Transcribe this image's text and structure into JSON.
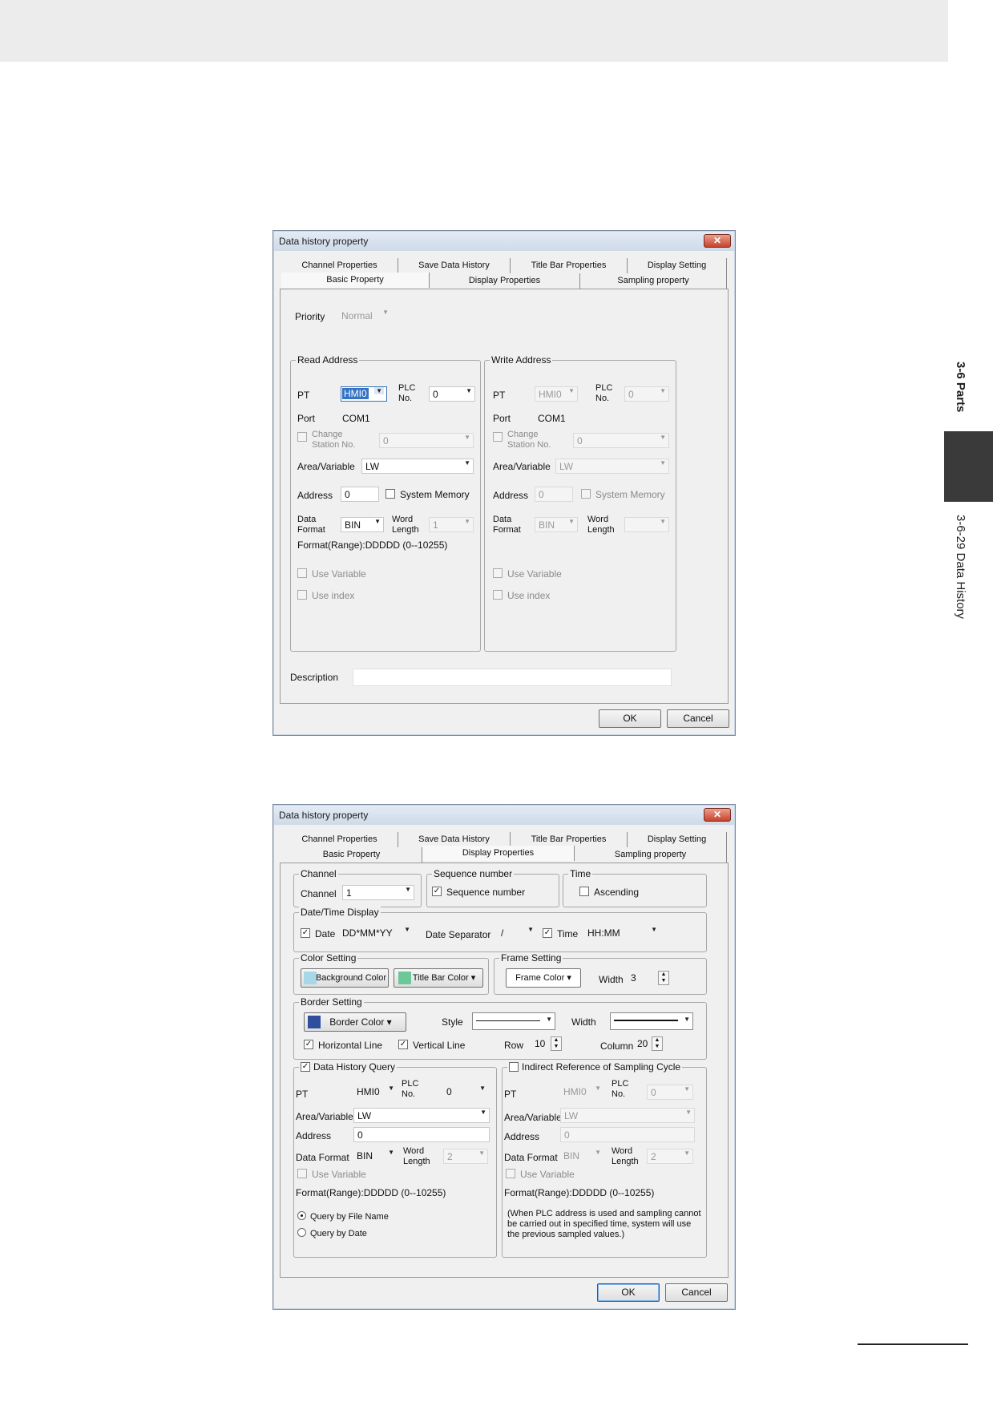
{
  "side": {
    "section": "3-6 Parts",
    "subsection": "3-6-29 Data History"
  },
  "dialog1": {
    "title": "Data history property",
    "close": "✕",
    "tabs_top": [
      "Channel Properties",
      "Save Data History",
      "Title Bar Properties",
      "Display Setting"
    ],
    "tabs_bottom": [
      "Basic Property",
      "Display Properties",
      "Sampling property"
    ],
    "priority_label": "Priority",
    "priority_value": "Normal",
    "read": {
      "title": "Read Address",
      "pt_label": "PT",
      "pt_value": "HMI0",
      "plc_label": "PLC No.",
      "plc_value": "0",
      "port_label": "Port",
      "port_value": "COM1",
      "change_station": "Change Station No.",
      "change_station_value": "0",
      "area_label": "Area/Variable",
      "area_value": "LW",
      "address_label": "Address",
      "address_value": "0",
      "system_memory": "System Memory",
      "data_format_label": "Data Format",
      "data_format_value": "BIN",
      "word_length_label": "Word Length",
      "word_length_value": "1",
      "format_range": "Format(Range):DDDDD (0--10255)",
      "use_variable": "Use Variable",
      "use_index": "Use index"
    },
    "write": {
      "title": "Write Address",
      "pt_label": "PT",
      "pt_value": "HMI0",
      "plc_label": "PLC No.",
      "plc_value": "0",
      "port_label": "Port",
      "port_value": "COM1",
      "change_station": "Change Station No.",
      "change_station_value": "0",
      "area_label": "Area/Variable",
      "area_value": "LW",
      "address_label": "Address",
      "address_value": "0",
      "system_memory": "System Memory",
      "data_format_label": "Data Format",
      "data_format_value": "BIN",
      "word_length_label": "Word Length",
      "use_variable": "Use Variable",
      "use_index": "Use index"
    },
    "description_label": "Description",
    "ok": "OK",
    "cancel": "Cancel"
  },
  "dialog2": {
    "title": "Data history property",
    "close": "✕",
    "tabs_top": [
      "Channel Properties",
      "Save Data History",
      "Title Bar Properties",
      "Display Setting"
    ],
    "tabs_bottom": [
      "Basic Property",
      "Display Properties",
      "Sampling property"
    ],
    "channel": {
      "title": "Channel",
      "label": "Channel",
      "value": "1"
    },
    "sequence": {
      "title": "Sequence number",
      "check_label": "Sequence number"
    },
    "time": {
      "title": "Time",
      "check_label": "Ascending"
    },
    "datetime": {
      "title": "Date/Time Display",
      "date_label": "Date",
      "date_value": "DD*MM*YY",
      "separator_label": "Date Separator",
      "separator_value": "/",
      "time_label": "Time",
      "time_value": "HH:MM"
    },
    "color": {
      "title": "Color Setting",
      "bg_label": "Background Color",
      "titlebar_label": "Title Bar Color",
      "bg_color": "#a8d8e8",
      "titlebar_color": "#6cc896"
    },
    "frame": {
      "title": "Frame Setting",
      "color_label": "Frame Color",
      "width_label": "Width",
      "width_value": "3",
      "frame_color": "#ffffff"
    },
    "border": {
      "title": "Border Setting",
      "color_label": "Border Color",
      "border_color": "#2f4f9e",
      "style_label": "Style",
      "width_label": "Width",
      "horizontal": "Horizontal Line",
      "vertical": "Vertical Line",
      "row_label": "Row",
      "row_value": "10",
      "column_label": "Column",
      "column_value": "20"
    },
    "query": {
      "title": "Data History Query",
      "pt_label": "PT",
      "pt_value": "HMI0",
      "plc_label": "PLC No.",
      "plc_value": "0",
      "area_label": "Area/Variable",
      "area_value": "LW",
      "address_label": "Address",
      "address_value": "0",
      "data_format_label": "Data Format",
      "data_format_value": "BIN",
      "word_length_label": "Word Length",
      "word_length_value": "2",
      "use_variable": "Use Variable",
      "format_range": "Format(Range):DDDDD (0--10255)",
      "by_file": "Query by File Name",
      "by_date": "Query by Date"
    },
    "indirect": {
      "title": "Indirect Reference of Sampling Cycle",
      "pt_label": "PT",
      "pt_value": "HMI0",
      "plc_label": "PLC No.",
      "plc_value": "0",
      "area_label": "Area/Variable",
      "area_value": "LW",
      "address_label": "Address",
      "address_value": "0",
      "data_format_label": "Data Format",
      "data_format_value": "BIN",
      "word_length_label": "Word Length",
      "word_length_value": "2",
      "use_variable": "Use Variable",
      "format_range": "Format(Range):DDDDD (0--10255)",
      "note": "(When PLC address is used and sampling cannot be carried out in specified time, system will use the previous sampled values.)"
    },
    "ok": "OK",
    "cancel": "Cancel"
  }
}
